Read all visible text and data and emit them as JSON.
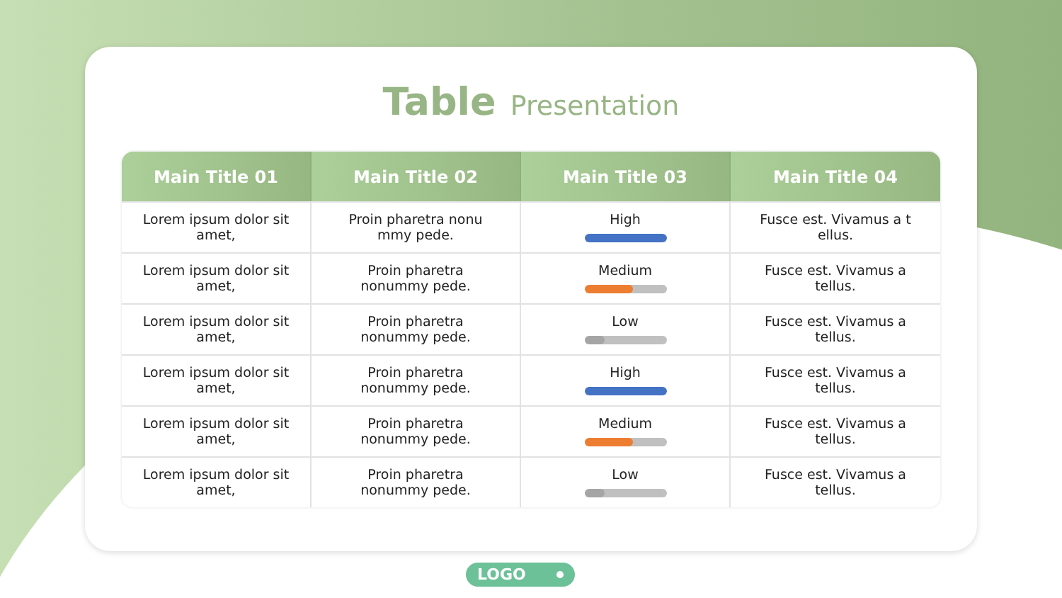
{
  "title": {
    "bold": "Table",
    "light": "Presentation"
  },
  "table": {
    "columns": [
      "Main Title 01",
      "Main Title 02",
      "Main Title 03",
      "Main Title 04"
    ],
    "rows": [
      {
        "col_1": "Lorem ipsum dolor sit\namet,",
        "col_2": "Proin pharetra nonu\nmmy pede.",
        "status": {
          "label": "High",
          "level": 1,
          "color": "#4472c4"
        },
        "col_4": "Fusce est. Vivamus a t\nellus."
      },
      {
        "col_1": "Lorem ipsum dolor sit\namet,",
        "col_2": "Proin pharetra\nnonummy pede.",
        "status": {
          "label": "Medium",
          "level": 0.6,
          "color": "#ed7d31"
        },
        "col_4": "Fusce est. Vivamus a\ntellus."
      },
      {
        "col_1": "Lorem ipsum dolor sit\namet,",
        "col_2": "Proin pharetra\nnonummy pede.",
        "status": {
          "label": "Low",
          "level": 0.25,
          "color": "#a5a5a5"
        },
        "col_4": "Fusce est. Vivamus a\ntellus."
      },
      {
        "col_1": "Lorem ipsum dolor sit\namet,",
        "col_2": "Proin pharetra\nnonummy pede.",
        "status": {
          "label": "High",
          "level": 1,
          "color": "#4472c4"
        },
        "col_4": "Fusce est. Vivamus a\ntellus."
      },
      {
        "col_1": "Lorem ipsum dolor sit\namet,",
        "col_2": "Proin pharetra\nnonummy pede.",
        "status": {
          "label": "Medium",
          "level": 0.6,
          "color": "#ed7d31"
        },
        "col_4": "Fusce est. Vivamus a\ntellus."
      },
      {
        "col_1": "Lorem ipsum dolor sit\namet,",
        "col_2": "Proin pharetra\nnonummy pede.",
        "status": {
          "label": "Low",
          "level": 0.25,
          "color": "#a5a5a5"
        },
        "col_4": "Fusce est. Vivamus a\ntellus."
      }
    ]
  },
  "logo": {
    "text": "LOGO"
  }
}
